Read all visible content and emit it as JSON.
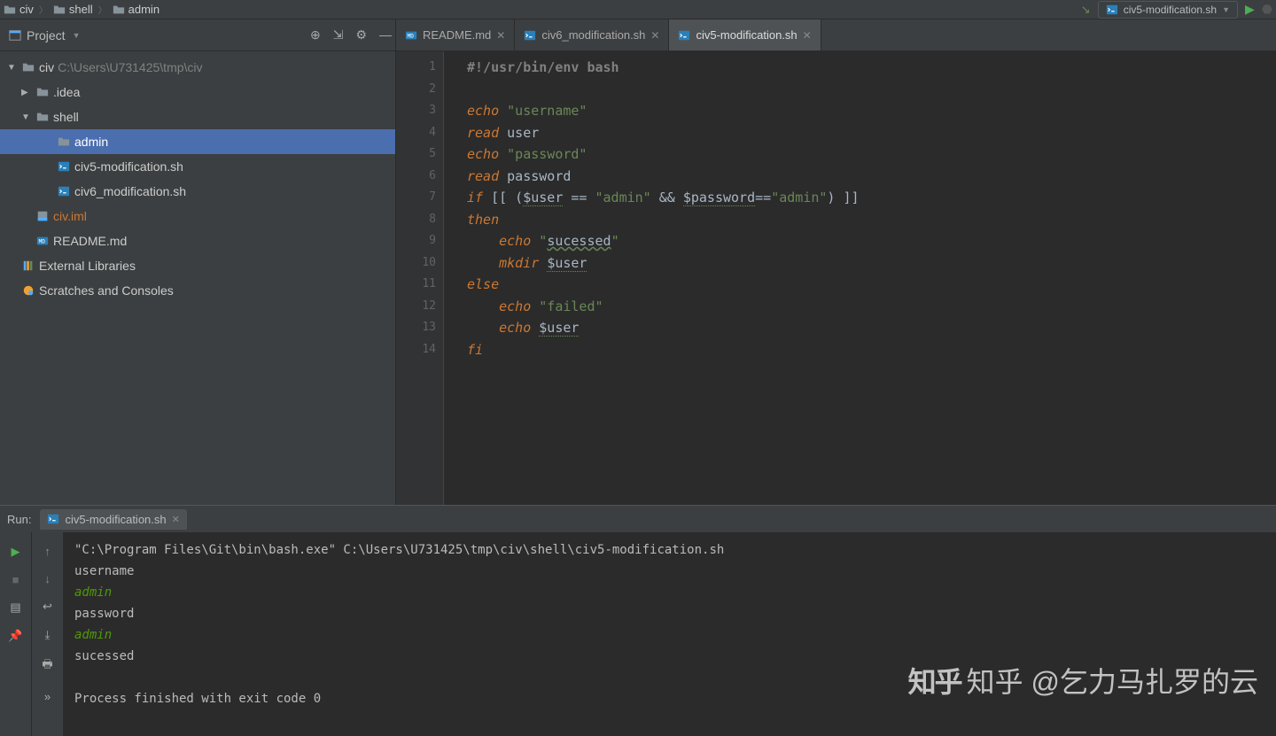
{
  "breadcrumbs": [
    {
      "icon": "folder",
      "label": "civ"
    },
    {
      "icon": "folder",
      "label": "shell"
    },
    {
      "icon": "folder",
      "label": "admin"
    }
  ],
  "run_config": {
    "label": "civ5-modification.sh"
  },
  "sidebar": {
    "title": "Project",
    "tree": [
      {
        "lvl": 0,
        "arrow": "▼",
        "icon": "folder",
        "label": "civ",
        "suffix": " C:\\Users\\U731425\\tmp\\civ",
        "selected": false,
        "interact": true
      },
      {
        "lvl": 1,
        "arrow": "▶",
        "icon": "folder",
        "label": ".idea",
        "suffix": "",
        "selected": false,
        "interact": true
      },
      {
        "lvl": 1,
        "arrow": "▼",
        "icon": "folder",
        "label": "shell",
        "suffix": "",
        "selected": false,
        "interact": true
      },
      {
        "lvl": 2,
        "arrow": "",
        "icon": "folder",
        "label": "admin",
        "suffix": "",
        "selected": true,
        "interact": true
      },
      {
        "lvl": 2,
        "arrow": "",
        "icon": "sh",
        "label": "civ5-modification.sh",
        "suffix": "",
        "selected": false,
        "interact": true
      },
      {
        "lvl": 2,
        "arrow": "",
        "icon": "sh",
        "label": "civ6_modification.sh",
        "suffix": "",
        "selected": false,
        "interact": true
      },
      {
        "lvl": 1,
        "arrow": "",
        "icon": "iml",
        "label": "civ.iml",
        "suffix": "",
        "selected": false,
        "interact": true,
        "orange": true
      },
      {
        "lvl": 1,
        "arrow": "",
        "icon": "md",
        "label": "README.md",
        "suffix": "",
        "selected": false,
        "interact": true
      },
      {
        "lvl": 0,
        "arrow": "",
        "icon": "lib",
        "label": "External Libraries",
        "suffix": "",
        "selected": false,
        "interact": true
      },
      {
        "lvl": 0,
        "arrow": "",
        "icon": "scratch",
        "label": "Scratches and Consoles",
        "suffix": "",
        "selected": false,
        "interact": true
      }
    ]
  },
  "tabs": [
    {
      "icon": "md",
      "label": "README.md",
      "active": false
    },
    {
      "icon": "sh",
      "label": "civ6_modification.sh",
      "active": false
    },
    {
      "icon": "sh",
      "label": "civ5-modification.sh",
      "active": true
    }
  ],
  "code": {
    "lines": [
      {
        "n": 1,
        "html": "<span class='shebang'>#!/usr/bin/env bash</span>"
      },
      {
        "n": 2,
        "html": ""
      },
      {
        "n": 3,
        "html": "<span class='kw'>echo</span> <span class='str'>\"username\"</span>"
      },
      {
        "n": 4,
        "html": "<span class='kw'>read</span> <span class='op'>user</span>"
      },
      {
        "n": 5,
        "html": "<span class='kw'>echo</span> <span class='str'>\"password\"</span>"
      },
      {
        "n": 6,
        "html": "<span class='kw'>read</span> <span class='op'>password</span>"
      },
      {
        "n": 7,
        "html": "<span class='kw'>if</span> <span class='op'>[[ (</span><span class='var'>$user</span> <span class='op'>==</span> <span class='str'>\"admin\"</span> <span class='op'>&amp;&amp;</span> <span class='var'>$password</span><span class='op'>==</span><span class='str'>\"admin\"</span><span class='op'>) ]]</span>"
      },
      {
        "n": 8,
        "html": "<span class='kw'>then</span>"
      },
      {
        "n": 9,
        "html": "    <span class='kw'>echo</span> <span class='str'>\"<span class='var' style='border:none;text-decoration:underline wavy #6a8759'>sucessed</span>\"</span>"
      },
      {
        "n": 10,
        "html": "    <span class='kw'>mkdir</span> <span class='var'>$user</span>"
      },
      {
        "n": 11,
        "html": "<span class='kw'>else</span>"
      },
      {
        "n": 12,
        "html": "    <span class='kw'>echo</span> <span class='str'>\"failed\"</span>"
      },
      {
        "n": 13,
        "html": "    <span class='kw'>echo</span> <span class='var'>$user</span>"
      },
      {
        "n": 14,
        "html": "<span class='kw'>fi</span>"
      }
    ]
  },
  "console": {
    "header_label": "Run:",
    "tab_label": "civ5-modification.sh",
    "output": [
      {
        "cls": "",
        "text": "\"C:\\Program Files\\Git\\bin\\bash.exe\" C:\\Users\\U731425\\tmp\\civ\\shell\\civ5-modification.sh"
      },
      {
        "cls": "",
        "text": "username"
      },
      {
        "cls": "input-text",
        "text": "admin"
      },
      {
        "cls": "",
        "text": "password"
      },
      {
        "cls": "input-text",
        "text": "admin"
      },
      {
        "cls": "",
        "text": "sucessed"
      },
      {
        "cls": "",
        "text": ""
      },
      {
        "cls": "",
        "text": "Process finished with exit code 0"
      }
    ]
  },
  "watermark": "知乎 @乞力马扎罗的云"
}
